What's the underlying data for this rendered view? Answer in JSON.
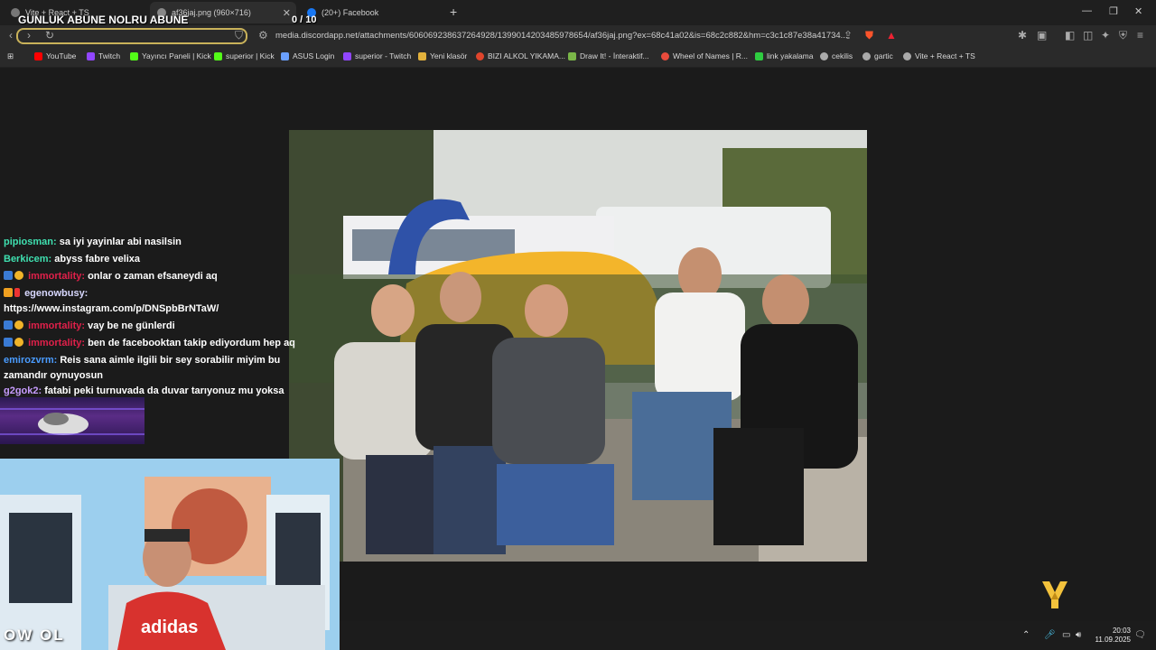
{
  "tabs": [
    {
      "label": "Vite + React + TS",
      "color": "#888888"
    },
    {
      "label": "af36jaj.png (960×716)",
      "color": "#888888"
    },
    {
      "label": "(20+) Facebook",
      "color": "#1877f2"
    }
  ],
  "overlay": {
    "title": "GUNLUK ABUNE NOLRU ABUNE",
    "counter": "0  / 10"
  },
  "address": {
    "url": "media.discordapp.net/attachments/606069238637264928/1399014203485978654/af36jaj.png?ex=68c41a02&is=68c2c882&hm=c3c1c87e38a41734..."
  },
  "bookmarks": [
    {
      "label": "YouTube",
      "color": "#ff0000"
    },
    {
      "label": "Twitch",
      "color": "#9146ff"
    },
    {
      "label": "Yayıncı Paneli | Kick",
      "color": "#53fc18"
    },
    {
      "label": "superior | Kick",
      "color": "#53fc18"
    },
    {
      "label": "ASUS Login",
      "color": "#6aa0ff"
    },
    {
      "label": "superior - Twitch",
      "color": "#9146ff"
    },
    {
      "label": "Yeni klasör",
      "color": "#e2b13c"
    },
    {
      "label": "BIZI ALKOL YIKAMA...",
      "color": "#e0452c"
    },
    {
      "label": "Draw It! - İnteraktif...",
      "color": "#7ab648"
    },
    {
      "label": "Wheel of Names | R...",
      "color": "#e94b3c"
    },
    {
      "label": "link yakalama",
      "color": "#2ecc40"
    },
    {
      "label": "cekilis",
      "color": "#aaaaaa"
    },
    {
      "label": "gartic",
      "color": "#aaaaaa"
    },
    {
      "label": "Vite + React + TS",
      "color": "#aaaaaa"
    }
  ],
  "chat": [
    {
      "user": "pipiosman:",
      "text": " sa iyi yayinlar abi nasilsin",
      "color": "#3fe0b0"
    },
    {
      "user": "Berkicem:",
      "text": " abyss fabre velixa",
      "color": "#3fe0b0"
    },
    {
      "user": "immortality:",
      "text": " onlar o zaman efsaneydi aq",
      "color": "#e0204a"
    },
    {
      "user": "egenowbusy:",
      "text": " https://www.instagram.com/p/DNSpbBrNTaW/",
      "color": "#d8d8ff"
    },
    {
      "user": "immortality:",
      "text": " vay be ne günlerdi",
      "color": "#e0204a"
    },
    {
      "user": "immortality:",
      "text": " ben de facebooktan takip ediyordum hep aq",
      "color": "#e0204a"
    },
    {
      "user": "emirozvrm:",
      "text": " Reis sana aimle ilgili bir sey sorabilir miyim bu zamandır oynuyosun",
      "color": "#4a9cff"
    },
    {
      "user": "g2gok2:",
      "text": " fatabi peki turnuvada da duvar tarıyonuz mu yoksa sadece online de mi tarıyolar",
      "color": "#c79cff"
    }
  ],
  "webcam": {
    "brand": "OW OL",
    "shirt": "adidas"
  },
  "clock": {
    "time": "20:03",
    "date": "11.09.2025"
  }
}
